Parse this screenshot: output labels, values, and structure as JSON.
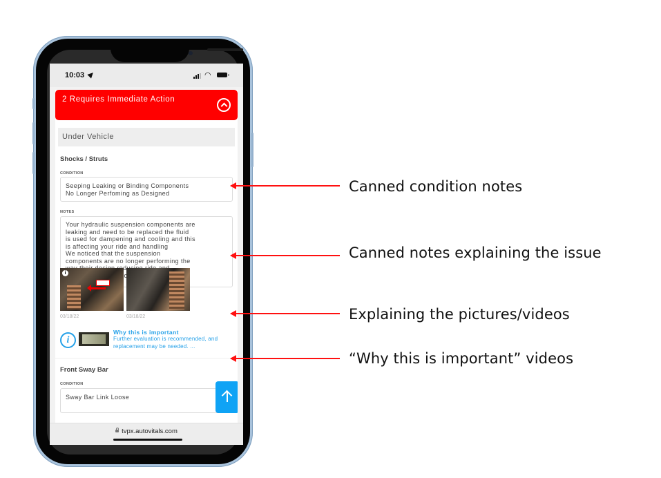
{
  "status_bar": {
    "time": "10:03"
  },
  "header": {
    "title": "2 Requires Immediate Action"
  },
  "section": {
    "title": "Under Vehicle"
  },
  "items": [
    {
      "title": "Shocks / Struts",
      "condition_label": "CONDITION",
      "condition_text": "Seeping Leaking or Binding Components\nNo Longer Perfoming as Designed",
      "notes_label": "NOTES",
      "notes_text": "Your hydraulic suspension components are\nleaking and need to be replaced the fluid\nis used for dampening and cooling and this\nis affecting your ride and handling\nWe noticed that the suspension\ncomponents are no longer performing the\nway their design reducing ride and\nhandling and likely causing tire wear",
      "photos": [
        {
          "date": "03/18/22",
          "badge": "i"
        },
        {
          "date": "03/18/22"
        }
      ],
      "why": {
        "title": "Why this is important",
        "description": "Further evaluation is recommended, and replacement may be needed. ..."
      }
    },
    {
      "title": "Front Sway Bar",
      "condition_label": "CONDITION",
      "condition_text": "Sway Bar Link Loose"
    }
  ],
  "browser": {
    "url": "tvpx.autovitals.com"
  },
  "annotations": [
    {
      "text": "Canned condition notes"
    },
    {
      "text": "Canned notes explaining the issue"
    },
    {
      "text": "Explaining the pictures/videos"
    },
    {
      "text": "“Why this is important” videos"
    }
  ],
  "colors": {
    "alert_red": "#ff0000",
    "accent_blue": "#23a0e8",
    "scroll_button": "#0fa3f5",
    "arrow_red": "#ff1010"
  }
}
